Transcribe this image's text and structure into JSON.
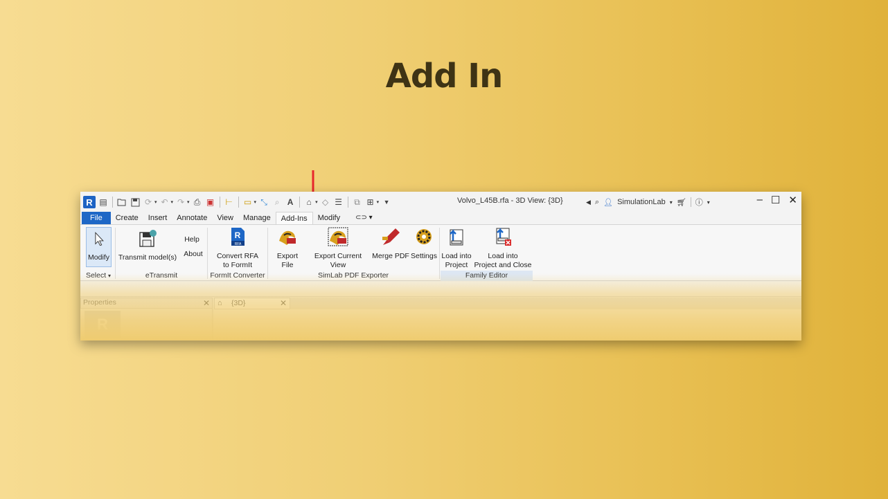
{
  "slide": {
    "title": "Add In"
  },
  "window": {
    "title": "Volvo_L45B.rfa - 3D View: {3D}",
    "user": "SimulationLab",
    "controls": {
      "minimize": "–",
      "maximize": "☐",
      "close": "✕"
    }
  },
  "tabs": [
    "File",
    "Create",
    "Insert",
    "Annotate",
    "View",
    "Manage",
    "Add-Ins",
    "Modify"
  ],
  "active_tab": "Add-Ins",
  "ribbon": {
    "modify": {
      "label": "Modify",
      "panel": "Select"
    },
    "etransmit": {
      "transmit": "Transmit model(s)",
      "help": "Help",
      "about": "About",
      "panel": "eTransmit"
    },
    "formit": {
      "convert_line1": "Convert RFA",
      "convert_line2": "to FormIt",
      "panel": "FormIt Converter"
    },
    "simlab": {
      "export_file": "Export File",
      "export_current_view": "Export Current View",
      "merge_pdf": "Merge PDF",
      "settings": "Settings",
      "panel": "SimLab PDF Exporter"
    },
    "family_editor": {
      "load_project_line1": "Load into",
      "load_project_line2": "Project",
      "load_close_line1": "Load into",
      "load_close_line2": "Project and Close",
      "panel": "Family Editor"
    }
  },
  "properties": {
    "header": "Properties"
  },
  "view_tab": {
    "label": "{3D}"
  },
  "colors": {
    "accent": "#1e67c6",
    "arrow": "#e8262c",
    "background": "#f0cf75"
  }
}
